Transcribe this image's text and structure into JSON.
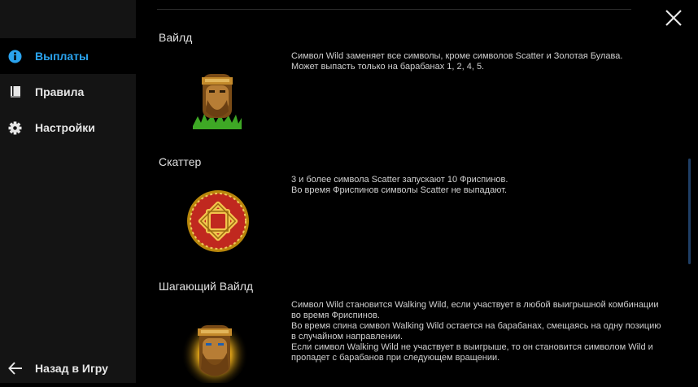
{
  "sidebar": {
    "items": [
      {
        "label": "Выплаты",
        "icon": "info-icon",
        "active": true
      },
      {
        "label": "Правила",
        "icon": "book-icon",
        "active": false
      },
      {
        "label": "Настройки",
        "icon": "gear-icon",
        "active": false
      }
    ],
    "back_label": "Назад в Игру"
  },
  "colors": {
    "accent": "#2aa3ee",
    "sidebar_bg": "#141414",
    "page_bg": "#000000"
  },
  "sections": [
    {
      "title": "Вайлд",
      "symbol": "wild-warrior-icon",
      "lines": [
        "Символ Wild заменяет все символы, кроме символов Scatter и Золотая Булава.",
        "Может выпасть только на барабанах 1, 2, 4, 5."
      ]
    },
    {
      "title": "Скаттер",
      "symbol": "scatter-knot-icon",
      "lines": [
        "3 и более символа Scatter запускают 10 Фриспинов.",
        "Во время Фриспинов символы Scatter не выпадают."
      ]
    },
    {
      "title": "Шагающий Вайлд",
      "symbol": "walking-wild-warrior-icon",
      "lines": [
        "Символ Wild становится Walking Wild, если участвует в любой выигрышной комбинации",
        "во время Фриспинов.",
        "Во время спина символ Walking Wild остается на барабанах, смещаясь на одну позицию",
        "в случайном направлении.",
        "Если символ Walking Wild не участвует в выигрыше, то он становится символом Wild и",
        "пропадет с барабанов при следующем вращении."
      ]
    }
  ]
}
